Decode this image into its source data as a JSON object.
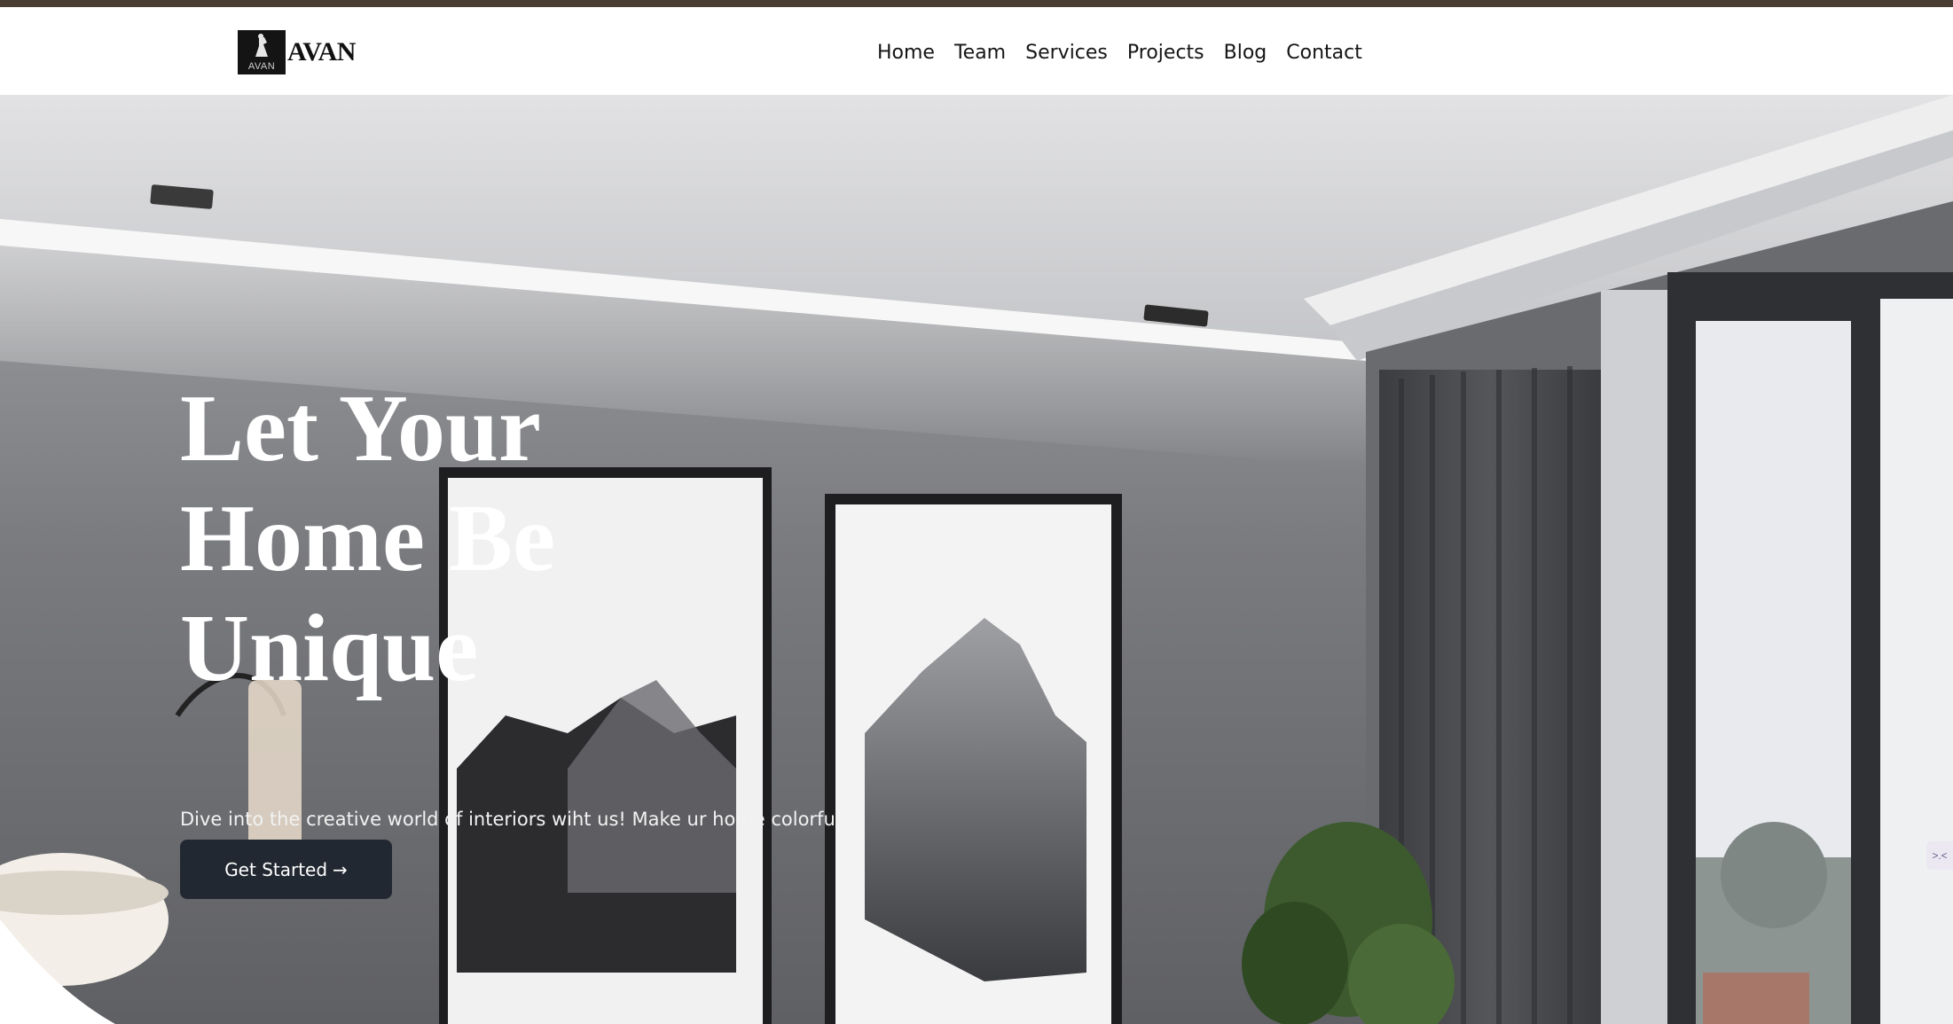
{
  "brand": {
    "name": "AVAN",
    "badge_text": "AVAN"
  },
  "nav": {
    "items": [
      {
        "label": "Home"
      },
      {
        "label": "Team"
      },
      {
        "label": "Services"
      },
      {
        "label": "Projects"
      },
      {
        "label": "Blog"
      },
      {
        "label": "Contact"
      }
    ]
  },
  "hero": {
    "title": "Let Your\nHome Be\nUnique",
    "subtitle": "Dive into the creative world of interiors wiht us! Make ur home colorful!",
    "cta_label": "Get Started",
    "cta_icon": "arrow-right-icon"
  },
  "side_widget": {
    "label": ">.<"
  },
  "colors": {
    "topbar": "#4a3e33",
    "cta_background": "#222831",
    "hero_text": "#ffffff"
  }
}
